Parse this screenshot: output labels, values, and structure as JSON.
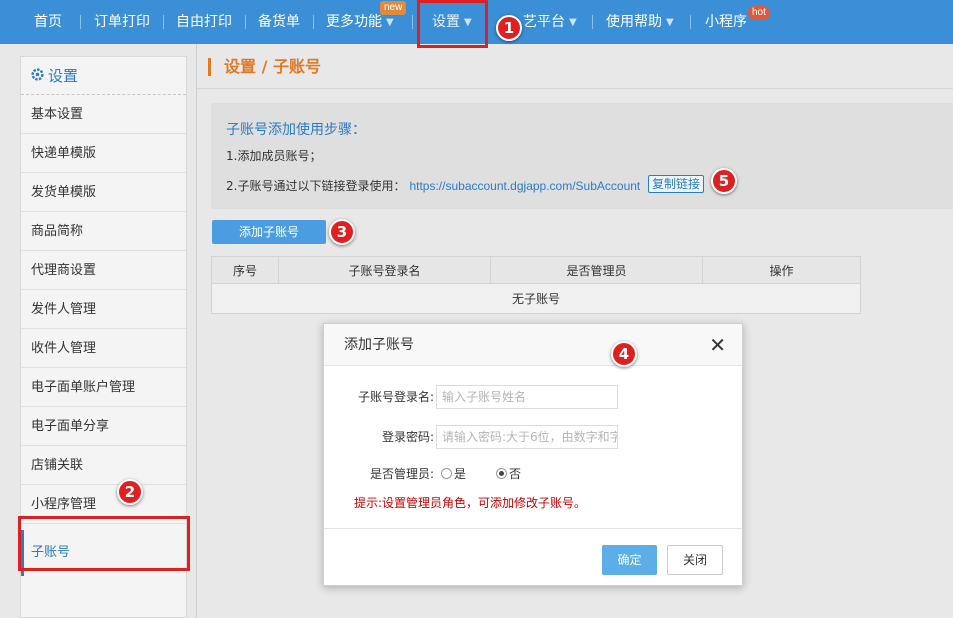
{
  "nav": {
    "items": [
      {
        "label": "首页",
        "arrow": ""
      },
      {
        "label": "订单打印",
        "arrow": ""
      },
      {
        "label": "自由打印",
        "arrow": ""
      },
      {
        "label": "备货单",
        "arrow": ""
      },
      {
        "label": "更多功能",
        "arrow": "▼"
      },
      {
        "label": "设置",
        "arrow": "▼"
      },
      {
        "label": "艺平台",
        "arrow": "▼"
      },
      {
        "label": "使用帮助",
        "arrow": "▼"
      },
      {
        "label": "小程序",
        "arrow": ""
      }
    ],
    "badge_new": "new",
    "badge_hot": "hot"
  },
  "sidebar": {
    "title": "设置",
    "items": [
      {
        "label": "基本设置"
      },
      {
        "label": "快递单模版"
      },
      {
        "label": "发货单模版"
      },
      {
        "label": "商品简称"
      },
      {
        "label": "代理商设置"
      },
      {
        "label": "发件人管理"
      },
      {
        "label": "收件人管理"
      },
      {
        "label": "电子面单账户管理"
      },
      {
        "label": "电子面单分享"
      },
      {
        "label": "店铺关联"
      },
      {
        "label": "小程序管理"
      },
      {
        "label": "子账号"
      }
    ]
  },
  "page": {
    "title": "设置 / 子账号",
    "steps_heading": "子账号添加使用步骤：",
    "step1": "1.添加成员账号；",
    "step2": "2.子账号通过以下链接登录使用：",
    "step2_link": "https://subaccount.dgjapp.com/SubAccount",
    "copy_link": "复制链接",
    "add_button": "添加子账号"
  },
  "table": {
    "headers": [
      "序号",
      "子账号登录名",
      "是否管理员",
      "操作"
    ],
    "empty": "无子账号"
  },
  "modal": {
    "title": "添加子账号",
    "close": "✕",
    "login_label": "子账号登录名:",
    "login_placeholder": "输入子账号姓名",
    "password_label": "登录密码:",
    "password_placeholder": "请输入密码:大于6位，由数字和字",
    "admin_label": "是否管理员:",
    "yes": "是",
    "no": "否",
    "admin_selected": "否",
    "hint": "提示:设置管理员角色，可添加修改子账号。",
    "ok": "确定",
    "cancel": "关闭"
  },
  "markers": [
    "1",
    "2",
    "3",
    "4",
    "5"
  ],
  "colors": {
    "nav": "#3a8fd6",
    "accent": "#2b7bc6",
    "title": "#e07a26",
    "annotation": "#e02020"
  }
}
